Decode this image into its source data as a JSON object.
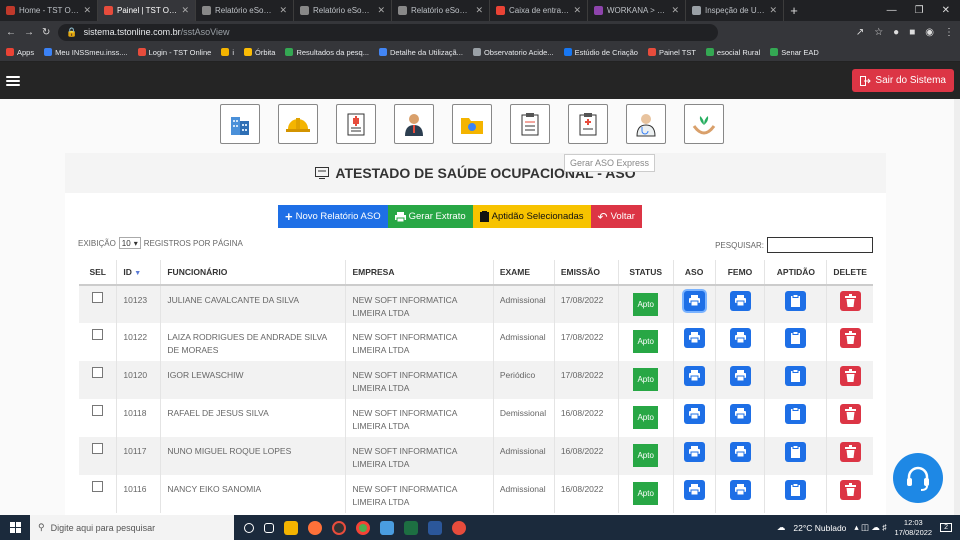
{
  "browser": {
    "tabs": [
      {
        "title": "Home - TST Onlin",
        "color": "#c0392b",
        "active": false
      },
      {
        "title": "Painel | TST ONLI",
        "color": "#e74c3c",
        "active": true
      },
      {
        "title": "Relatório eSocial",
        "color": "#888888",
        "active": false
      },
      {
        "title": "Relatório eSocial",
        "color": "#888888",
        "active": false
      },
      {
        "title": "Relatório eSocial",
        "color": "#888888",
        "active": false
      },
      {
        "title": "Caixa de entrada",
        "color": "#ea4335",
        "active": false
      },
      {
        "title": "WORKANA > Enc",
        "color": "#8e44ad",
        "active": false
      },
      {
        "title": "Inspeção de URL",
        "color": "#9aa0a6",
        "active": false
      }
    ],
    "url_host": "sistema.tstonline.com.br",
    "url_path": "/sstAsoView",
    "bookmarks": [
      "Apps",
      "Meu INSSmeu.inss....",
      "Login - TST Online",
      "i",
      "Órbita",
      "Resultados da pesq...",
      "Detalhe da Utilizaçã...",
      "Observatorio Acide...",
      "Estúdio de Criação",
      "Painel TST",
      "esocial Rural",
      "Senar EAD"
    ]
  },
  "header": {
    "logout_label": "Sair do Sistema"
  },
  "tooltip": "Gerar ASO Express",
  "page": {
    "title": "ATESTADO DE SAÚDE OCUPACIONAL - ASO",
    "buttons": {
      "new_report": "Novo Relatório ASO",
      "extract": "Gerar Extrato",
      "aptitude": "Aptidão Selecionadas",
      "back": "Voltar"
    },
    "length_prefix": "EXIBIÇÃO",
    "length_value": "10",
    "length_suffix": "REGISTROS POR PÁGINA",
    "search_label": "PESQUISAR:"
  },
  "table": {
    "headers": {
      "sel": "SEL",
      "id": "ID",
      "funcionario": "FUNCIONÁRIO",
      "empresa": "EMPRESA",
      "exame": "EXAME",
      "emissao": "EMISSÃO",
      "status": "STATUS",
      "aso": "ASO",
      "femo": "FEMO",
      "aptidao": "APTIDÃO",
      "delete": "DELETE"
    },
    "rows": [
      {
        "id": "10123",
        "funcionario": "JULIANE CAVALCANTE DA SILVA",
        "empresa": "NEW SOFT INFORMATICA LIMEIRA LTDA",
        "exame": "Admissional",
        "emissao": "17/08/2022",
        "status": "Apto"
      },
      {
        "id": "10122",
        "funcionario": "LAIZA RODRIGUES DE ANDRADE SILVA DE MORAES",
        "empresa": "NEW SOFT INFORMATICA LIMEIRA LTDA",
        "exame": "Admissional",
        "emissao": "17/08/2022",
        "status": "Apto"
      },
      {
        "id": "10120",
        "funcionario": "IGOR LEWASCHIW",
        "empresa": "NEW SOFT INFORMATICA LIMEIRA LTDA",
        "exame": "Periódico",
        "emissao": "17/08/2022",
        "status": "Apto"
      },
      {
        "id": "10118",
        "funcionario": "RAFAEL DE JESUS SILVA",
        "empresa": "NEW SOFT INFORMATICA LIMEIRA LTDA",
        "exame": "Demissional",
        "emissao": "16/08/2022",
        "status": "Apto"
      },
      {
        "id": "10117",
        "funcionario": "NUNO MIGUEL ROQUE LOPES",
        "empresa": "NEW SOFT INFORMATICA LIMEIRA LTDA",
        "exame": "Admissional",
        "emissao": "16/08/2022",
        "status": "Apto"
      },
      {
        "id": "10116",
        "funcionario": "NANCY EIKO SANOMIA",
        "empresa": "NEW SOFT INFORMATICA LIMEIRA LTDA",
        "exame": "Admissional",
        "emissao": "16/08/2022",
        "status": "Apto"
      }
    ]
  },
  "taskbar": {
    "search_placeholder": "Digite aqui para pesquisar",
    "weather": "22°C  Nublado",
    "time": "12:03",
    "date": "17/08/2022",
    "notifications": "2"
  }
}
